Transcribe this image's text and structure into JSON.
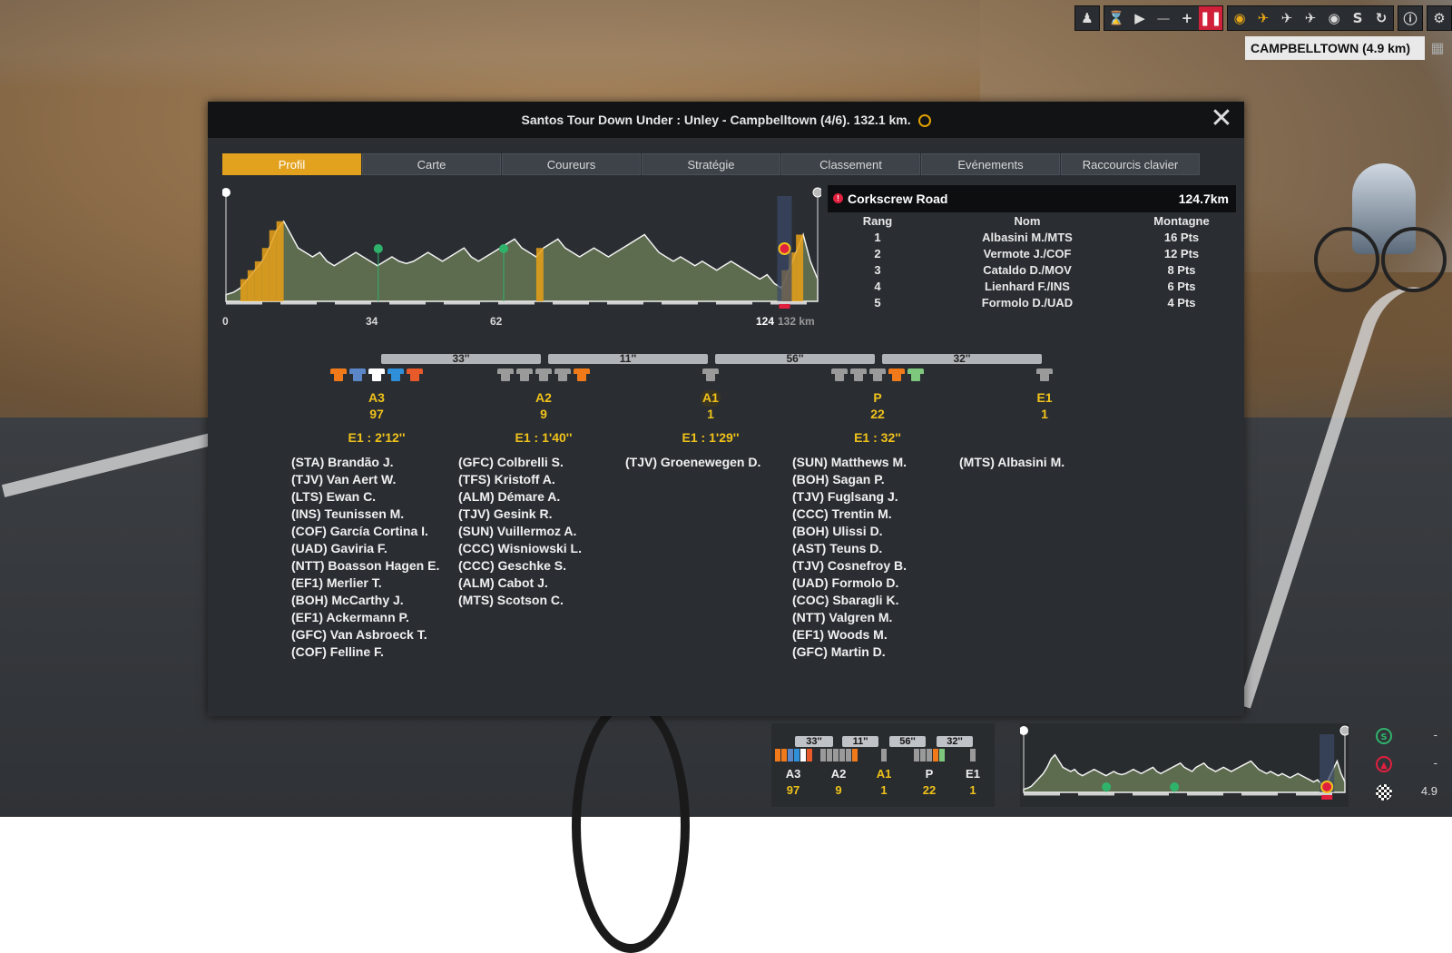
{
  "location": "CAMPBELLTOWN (4.9 km)",
  "toolbar_icons": [
    "rider-icon",
    "hourglass-icon",
    "play-icon",
    "minus-icon",
    "plus-icon",
    "pause-icon",
    "eye-icon",
    "motorbike-icon",
    "helicopter-icon",
    "plane-icon",
    "ball-icon",
    "s-icon",
    "refresh-icon",
    "info-icon",
    "gear-icon"
  ],
  "modal": {
    "title": "Santos Tour Down Under : Unley - Campbelltown (4/6). 132.1 km.",
    "tabs": [
      "Profil",
      "Carte",
      "Coureurs",
      "Stratégie",
      "Classement",
      "Evénements",
      "Raccourcis clavier"
    ],
    "active_tab": "Profil"
  },
  "profile": {
    "km_labels": [
      "0",
      "34",
      "62",
      "124",
      "132 km"
    ],
    "sprints_km": [
      34,
      62
    ],
    "kom_km": 124.7,
    "total_km": 132.1,
    "elevation": [
      3,
      4,
      6,
      10,
      14,
      18,
      24,
      32,
      36,
      30,
      24,
      22,
      20,
      22,
      18,
      16,
      18,
      20,
      22,
      20,
      18,
      16,
      18,
      20,
      18,
      17,
      18,
      20,
      22,
      20,
      18,
      20,
      22,
      24,
      20,
      18,
      20,
      22,
      24,
      26,
      28,
      24,
      22,
      20,
      24,
      26,
      28,
      24,
      22,
      20,
      22,
      24,
      22,
      20,
      22,
      24,
      26,
      28,
      30,
      26,
      22,
      20,
      18,
      20,
      18,
      16,
      18,
      16,
      14,
      16,
      18,
      16,
      14,
      12,
      10,
      12,
      8,
      6,
      14,
      22,
      30,
      18,
      10
    ]
  },
  "climb": {
    "name": "Corkscrew Road",
    "km": "124.7km",
    "headers": [
      "Rang",
      "Nom",
      "Montagne"
    ],
    "rows": [
      [
        "1",
        "Albasini M./MTS",
        "16 Pts"
      ],
      [
        "2",
        "Vermote J./COF",
        "12 Pts"
      ],
      [
        "3",
        "Cataldo D./MOV",
        "8 Pts"
      ],
      [
        "4",
        "Lienhard F./INS",
        "6 Pts"
      ],
      [
        "5",
        "Formolo D./UAD",
        "4 Pts"
      ]
    ]
  },
  "gaps": [
    "33''",
    "11''",
    "56''",
    "32''"
  ],
  "groups": [
    {
      "name": "A3",
      "count": "97",
      "time": "E1 : 2'12''",
      "jerseys": [
        "#f07a1a",
        "#5b86c7",
        "#ffffff",
        "#2f8fd8",
        "#e85a2a"
      ],
      "riders": [
        "(STA) Brandão J.",
        "(TJV) Van Aert W.",
        "(LTS) Ewan C.",
        "(INS) Teunissen M.",
        "(COF) García Cortina I.",
        "(UAD) Gaviria F.",
        "(NTT) Boasson Hagen E.",
        "(EF1) Merlier T.",
        "(BOH) McCarthy J.",
        "(EF1) Ackermann P.",
        "(GFC) Van Asbroeck T.",
        "(COF) Felline F."
      ]
    },
    {
      "name": "A2",
      "count": "9",
      "time": "E1 : 1'40''",
      "jerseys": [
        "#9a9a9a",
        "#9a9a9a",
        "#9a9a9a",
        "#9a9a9a",
        "#f07a1a"
      ],
      "riders": [
        "(GFC) Colbrelli S.",
        "(TFS) Kristoff A.",
        "(ALM) Démare A.",
        "(TJV) Gesink R.",
        "(SUN) Vuillermoz A.",
        "(CCC) Wisniowski L.",
        "(CCC) Geschke S.",
        "(ALM) Cabot J.",
        "(MTS) Scotson C."
      ]
    },
    {
      "name": "A1",
      "count": "1",
      "time": "E1 : 1'29''",
      "jerseys": [
        "#9a9a9a"
      ],
      "riders": [
        "(TJV) Groenewegen D."
      ]
    },
    {
      "name": "P",
      "count": "22",
      "time": "E1 : 32''",
      "jerseys": [
        "#9a9a9a",
        "#9a9a9a",
        "#9a9a9a",
        "#f07a1a",
        "#7ec87e"
      ],
      "riders": [
        "(SUN) Matthews M.",
        "(BOH) Sagan P.",
        "(TJV) Fuglsang J.",
        "(CCC) Trentin M.",
        "(BOH) Ulissi D.",
        "(AST) Teuns D.",
        "(TJV) Cosnefroy B.",
        "(UAD) Formolo D.",
        "(COC) Sbaragli K.",
        "(NTT) Valgren M.",
        "(EF1) Woods M.",
        "(GFC) Martin D."
      ]
    },
    {
      "name": "E1",
      "count": "1",
      "time": "",
      "jerseys": [
        "#9a9a9a"
      ],
      "riders": [
        "(MTS) Albasini M."
      ]
    }
  ],
  "hud": {
    "gaps": [
      "33''",
      "11''",
      "56''",
      "32''"
    ],
    "groups": [
      {
        "name": "A3",
        "count": "97",
        "jerseys": [
          "#f07a1a",
          "#f07a1a",
          "#5b86c7",
          "#2f8fd8",
          "#ffffff",
          "#e85a2a"
        ]
      },
      {
        "name": "A2",
        "count": "9",
        "jerseys": [
          "#9a9a9a",
          "#9a9a9a",
          "#9a9a9a",
          "#9a9a9a",
          "#9a9a9a",
          "#f07a1a"
        ]
      },
      {
        "name": "A1",
        "count": "1",
        "jerseys": [
          "#9a9a9a"
        ]
      },
      {
        "name": "P",
        "count": "22",
        "jerseys": [
          "#9a9a9a",
          "#9a9a9a",
          "#9a9a9a",
          "#f07a1a",
          "#7ec87e"
        ]
      },
      {
        "name": "E1",
        "count": "1",
        "jerseys": [
          "#9a9a9a"
        ]
      }
    ],
    "side": [
      {
        "icon": "sprint-icon",
        "value": "-"
      },
      {
        "icon": "climb-icon",
        "value": "-"
      },
      {
        "icon": "finish-flag-icon",
        "value": "4.9"
      }
    ]
  }
}
